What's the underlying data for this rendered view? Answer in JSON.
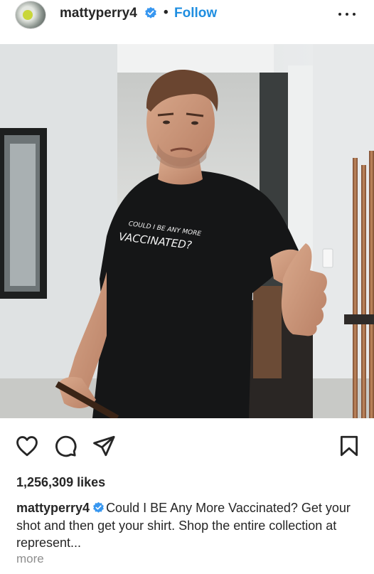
{
  "post": {
    "username": "mattyperry4",
    "separator": "•",
    "follow_label": "Follow",
    "accent_color": "#1f8ee0",
    "verified_color": "#3897f0"
  },
  "image": {
    "shirt_text_line1": "COULD I BE ANY MORE",
    "shirt_text_line2": "VACCINATED?"
  },
  "actions": {
    "icons": [
      "heart-icon",
      "comment-icon",
      "share-icon",
      "bookmark-icon"
    ]
  },
  "likes": "1,256,309 likes",
  "caption": {
    "username": "mattyperry4",
    "text": "Could I BE Any More Vaccinated? Get your shot and then get your shirt. Shop the entire collection at represent...",
    "more_label": "more"
  }
}
